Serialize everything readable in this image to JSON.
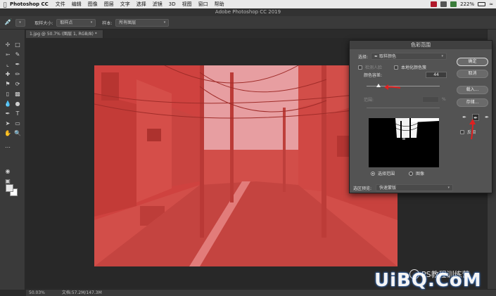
{
  "menubar": {
    "app_name": "Photoshop CC",
    "items": [
      "文件",
      "编辑",
      "图像",
      "图层",
      "文字",
      "选择",
      "滤镜",
      "3D",
      "视图",
      "窗口",
      "帮助"
    ],
    "battery": "222%"
  },
  "window": {
    "title": "Adobe Photoshop CC 2019"
  },
  "options": {
    "sample_size_label": "取样大小:",
    "sample_size_value": "取样点",
    "sample_label": "样本:",
    "sample_value": "所有图层"
  },
  "document": {
    "tab_label": "1.jpg @ 50.7% (图层 1, RGB/8) *",
    "zoom": "50.03%",
    "doc_info": "文档:57.2M/147.3M"
  },
  "dialog": {
    "title": "色彩范围",
    "select_label": "选择:",
    "select_value": "取样颜色",
    "detect_faces_label": "检测人脸",
    "localized_label": "本地化颜色簇",
    "fuzziness_label": "颜色容差:",
    "fuzziness_value": "44",
    "fuzziness_fraction": 0.16,
    "range_label": "范围:",
    "range_unit": "%",
    "selection_radio": "选择范围",
    "image_radio": "图像",
    "preview_label": "选区预览:",
    "preview_value": "快速蒙版",
    "invert_label": "反相",
    "buttons": {
      "ok": "确定",
      "cancel": "取消",
      "load": "载入...",
      "save": "存储..."
    }
  },
  "watermark": {
    "small": "PS教程训练营",
    "large": "UiBQ.CoM"
  },
  "colors": {
    "overlay_red": "#e53935",
    "annotation_red": "#e02020",
    "ui_dark": "#2b2b2b",
    "dialog_bg": "#535353"
  }
}
